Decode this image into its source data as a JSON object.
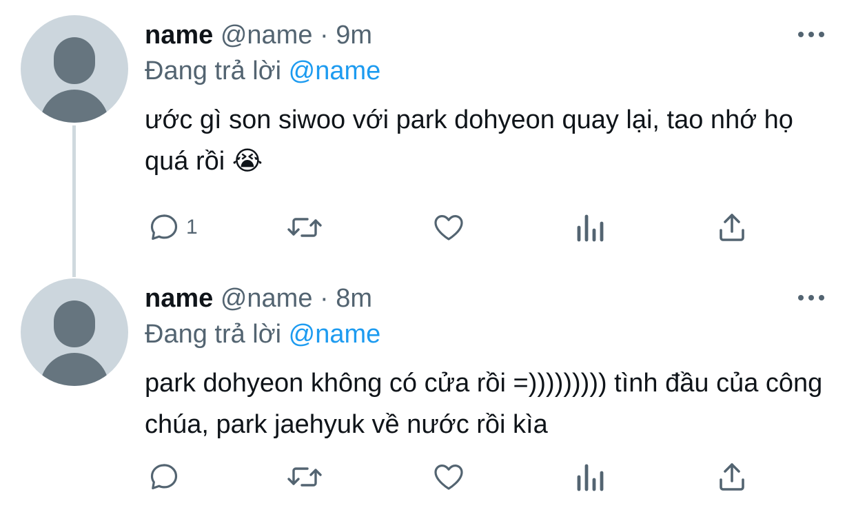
{
  "tweets": [
    {
      "display_name": "name",
      "handle": "@name",
      "separator": "·",
      "time": "9m",
      "reply_prefix": "Đang trả lời",
      "reply_to": "@name",
      "text": "ước gì son siwoo với park dohyeon quay lại, tao nhớ họ quá rồi 😭",
      "reply_count": "1",
      "icons": [
        "reply-icon",
        "retweet-icon",
        "like-icon",
        "analytics-icon",
        "share-icon",
        "more-icon"
      ]
    },
    {
      "display_name": "name",
      "handle": "@name",
      "separator": "·",
      "time": "8m",
      "reply_prefix": "Đang trả lời",
      "reply_to": "@name",
      "text": "park dohyeon không có cửa rồi =))))))))) tình đầu của công chúa, park jaehyuk về nước rồi kìa",
      "reply_count": "",
      "icons": [
        "reply-icon",
        "retweet-icon",
        "like-icon",
        "analytics-icon",
        "share-icon",
        "more-icon"
      ]
    }
  ],
  "colors": {
    "text": "#0f1419",
    "secondary": "#536471",
    "link": "#1d9bf0",
    "avatar_bg": "#ccd6dd",
    "avatar_fg": "#66757f",
    "thread_line": "#cfd9de"
  }
}
